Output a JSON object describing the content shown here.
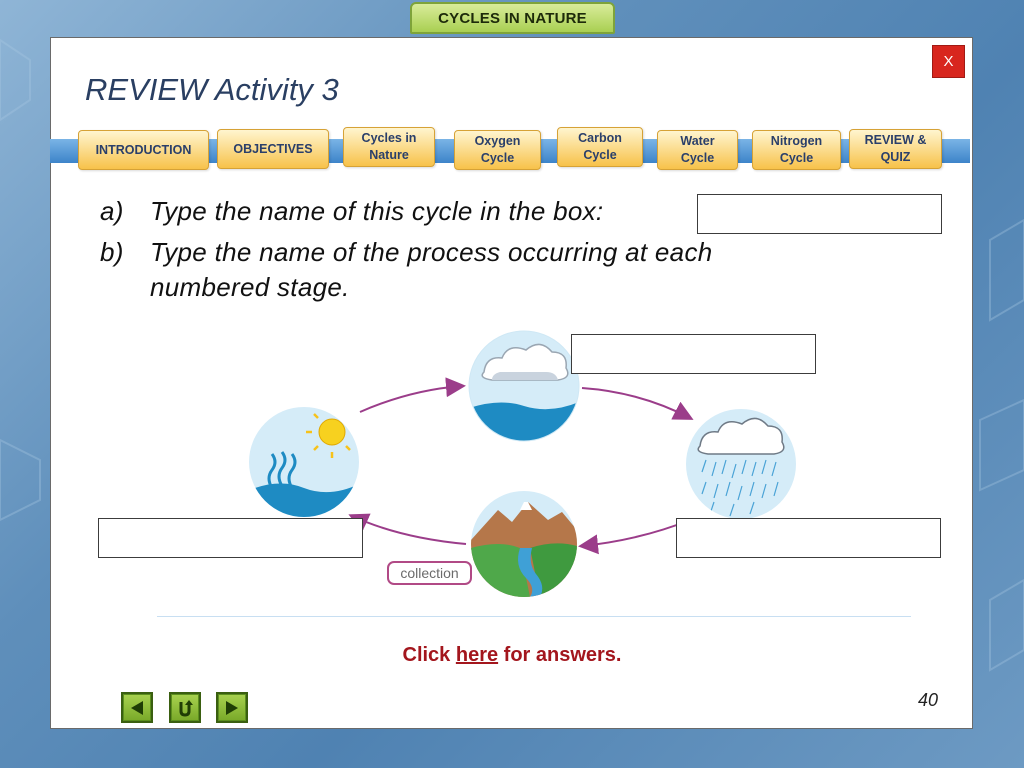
{
  "header": {
    "course_tab": "CYCLES IN NATURE"
  },
  "window": {
    "close_label": "X"
  },
  "title": "REVIEW Activity 3",
  "nav": {
    "items": [
      {
        "label_lines": [
          "INTRODUCTION"
        ]
      },
      {
        "label_lines": [
          "OBJECTIVES"
        ]
      },
      {
        "label_lines": [
          "Cycles in",
          "Nature"
        ]
      },
      {
        "label_lines": [
          "Oxygen",
          "Cycle"
        ]
      },
      {
        "label_lines": [
          "Carbon",
          "Cycle"
        ]
      },
      {
        "label_lines": [
          "Water",
          "Cycle"
        ]
      },
      {
        "label_lines": [
          "Nitrogen",
          "Cycle"
        ]
      },
      {
        "label_lines": [
          "REVIEW &",
          "QUIZ"
        ]
      }
    ]
  },
  "questions": {
    "a_label": "a)",
    "a_text": "Type the name of this cycle in the box:",
    "b_label": "b)",
    "b_text_line1": "Type the name of the process occurring at each",
    "b_text_line2": "numbered stage."
  },
  "diagram": {
    "collection_label": "collection",
    "stages": [
      "evaporation-scene",
      "condensation-scene",
      "precipitation-scene",
      "collection-scene"
    ]
  },
  "answers": {
    "prefix": "Click ",
    "link": "here",
    "suffix": " for answers."
  },
  "footer": {
    "page_number": "40",
    "back_icon": "arrow-left-icon",
    "return_icon": "u-turn-icon",
    "forward_icon": "arrow-right-icon"
  },
  "colors": {
    "accent_green": "#a9cf52",
    "nav_button": "#f7c24a",
    "close_red": "#d8261e",
    "answer_red": "#a3161d",
    "arrow_purple": "#9b3d8a"
  }
}
